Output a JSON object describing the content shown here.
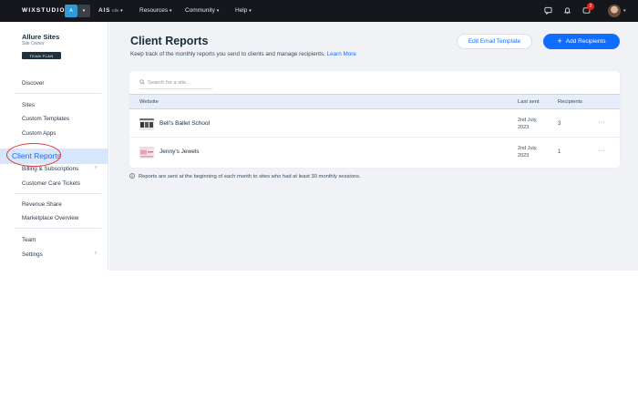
{
  "topbar": {
    "logo": "WIXSTUDIO",
    "workspace_initial": "A",
    "workspace_arrow": "▾",
    "account_label": "AIS",
    "account_badge": "Idle",
    "account_caret": "▾",
    "nav": [
      {
        "label": "Resources",
        "caret": "▾"
      },
      {
        "label": "Community",
        "caret": "▾"
      },
      {
        "label": "Help",
        "caret": "▾"
      }
    ],
    "notification_count": "2"
  },
  "sidebar": {
    "account_name": "Allure Sites",
    "account_role": "Site Owner",
    "account_button": "TEAM PLAN",
    "items": [
      {
        "label": "Discover"
      },
      {
        "label": "Sites"
      },
      {
        "label": "Custom Templates"
      },
      {
        "label": "Custom Apps"
      },
      {
        "label": "Client Reports"
      },
      {
        "label": "Billing & Subscriptions",
        "caret": "›"
      },
      {
        "label": "Customer Care Tickets"
      },
      {
        "label": "Revenue Share"
      },
      {
        "label": "Marketplace Overview"
      },
      {
        "label": "Team"
      },
      {
        "label": "Settings",
        "caret": "›"
      }
    ]
  },
  "main": {
    "title": "Client Reports",
    "subtitle": "Keep track of the monthly reports you send to clients and manage recipients.",
    "learn_more": "Learn More",
    "edit_button": "Edit Email Template",
    "add_button": "Add Recipients",
    "search_placeholder": "Search for a site...",
    "columns": {
      "website": "Website",
      "last_sent": "Last sent",
      "recipients": "Recipients"
    },
    "rows": [
      {
        "site": "Bell's Ballet School",
        "last_sent": "2nd July, 2023",
        "recipients": "3",
        "thumb_color": "#6c6f74"
      },
      {
        "site": "Jenny's Jewels",
        "last_sent": "2nd July, 2023",
        "recipients": "1",
        "thumb_color": "#e8a1b6"
      }
    ],
    "more_glyph": "···",
    "footnote": "Reports are sent at the beginning of each month to sites who had at least 30 monthly sessions."
  },
  "colors": {
    "accent": "#116dff",
    "topbar": "#15171c",
    "active_bg": "#d7e6fb",
    "highlight_ring": "#e0393e"
  }
}
